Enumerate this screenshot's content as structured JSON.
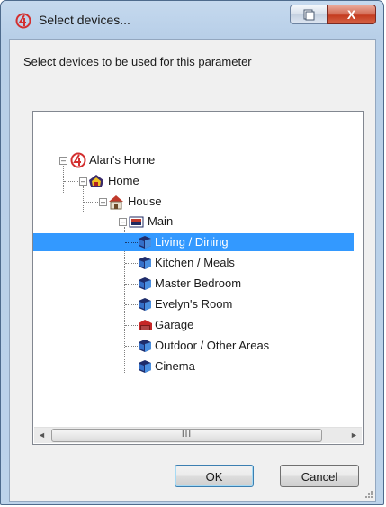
{
  "window": {
    "title": "Select devices...",
    "close_glyph": "X"
  },
  "prompt": "Select devices to be used for this parameter",
  "tree": {
    "root": "Alan's Home",
    "home": "Home",
    "house": "House",
    "main": "Main",
    "rooms": [
      {
        "label": "Living / Dining",
        "icon": "room-icon",
        "selected": true
      },
      {
        "label": "Kitchen / Meals",
        "icon": "room-icon",
        "selected": false
      },
      {
        "label": "Master Bedroom",
        "icon": "room-icon",
        "selected": false
      },
      {
        "label": "Evelyn's Room",
        "icon": "room-icon",
        "selected": false
      },
      {
        "label": "Garage",
        "icon": "garage-icon",
        "selected": false
      },
      {
        "label": "Outdoor / Other Areas",
        "icon": "room-icon",
        "selected": false
      },
      {
        "label": "Cinema",
        "icon": "room-icon",
        "selected": false
      }
    ]
  },
  "scrollbar": {
    "thumb_grip": "III",
    "left_arrow": "◄",
    "right_arrow": "►"
  },
  "buttons": {
    "ok": "OK",
    "cancel": "Cancel"
  },
  "colors": {
    "selection": "#3399ff",
    "accent_logo": "#d32f2f"
  }
}
